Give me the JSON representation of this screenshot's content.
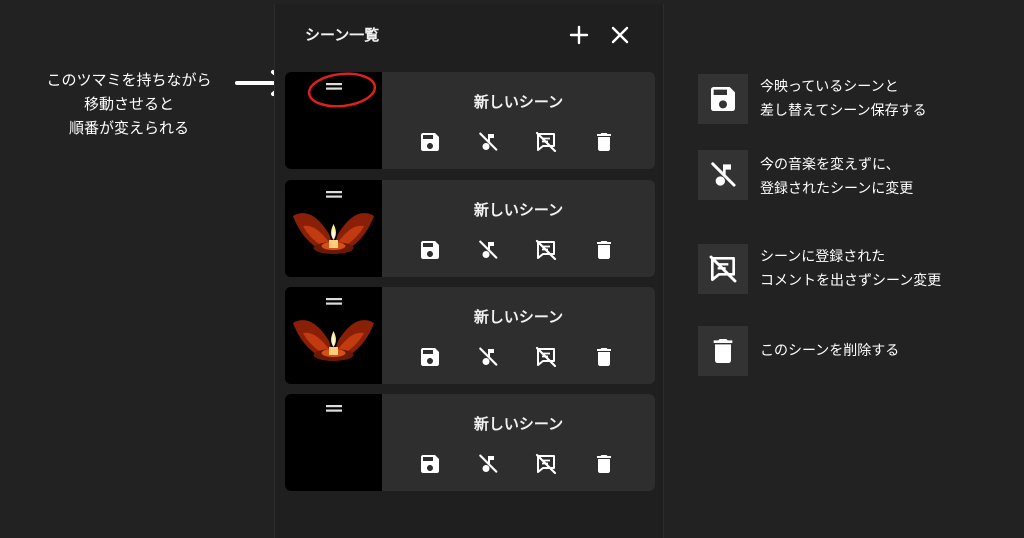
{
  "panel": {
    "title": "シーン一覧",
    "add_icon": "plus-icon",
    "close_icon": "close-icon"
  },
  "scenes": [
    {
      "name": "新しいシーン",
      "thumbnail": "black"
    },
    {
      "name": "新しいシーン",
      "thumbnail": "candle-in-hands"
    },
    {
      "name": "新しいシーン",
      "thumbnail": "candle-in-hands"
    },
    {
      "name": "新しいシーン",
      "thumbnail": "black"
    }
  ],
  "scene_actions": [
    "save-icon",
    "music-off-icon",
    "comment-off-icon",
    "trash-icon"
  ],
  "annotation": {
    "lines": [
      "このツマミを持ちながら",
      "移動させると",
      "順番が変えられる"
    ],
    "highlight_color": "#e02020"
  },
  "legend": [
    {
      "icon": "save-icon",
      "lines": [
        "今映っているシーンと",
        "差し替えてシーン保存する"
      ]
    },
    {
      "icon": "music-off-icon",
      "lines": [
        "今の音楽を変えずに、",
        "登録されたシーンに変更"
      ]
    },
    {
      "icon": "comment-off-icon",
      "lines": [
        "シーンに登録された",
        "コメントを出さずシーン変更"
      ]
    },
    {
      "icon": "trash-icon",
      "lines": [
        "このシーンを削除する"
      ]
    }
  ],
  "colors": {
    "background": "#222222",
    "panel": "#1f1f1f",
    "card": "#2e2e2e",
    "legend_icon_bg": "#333333"
  }
}
